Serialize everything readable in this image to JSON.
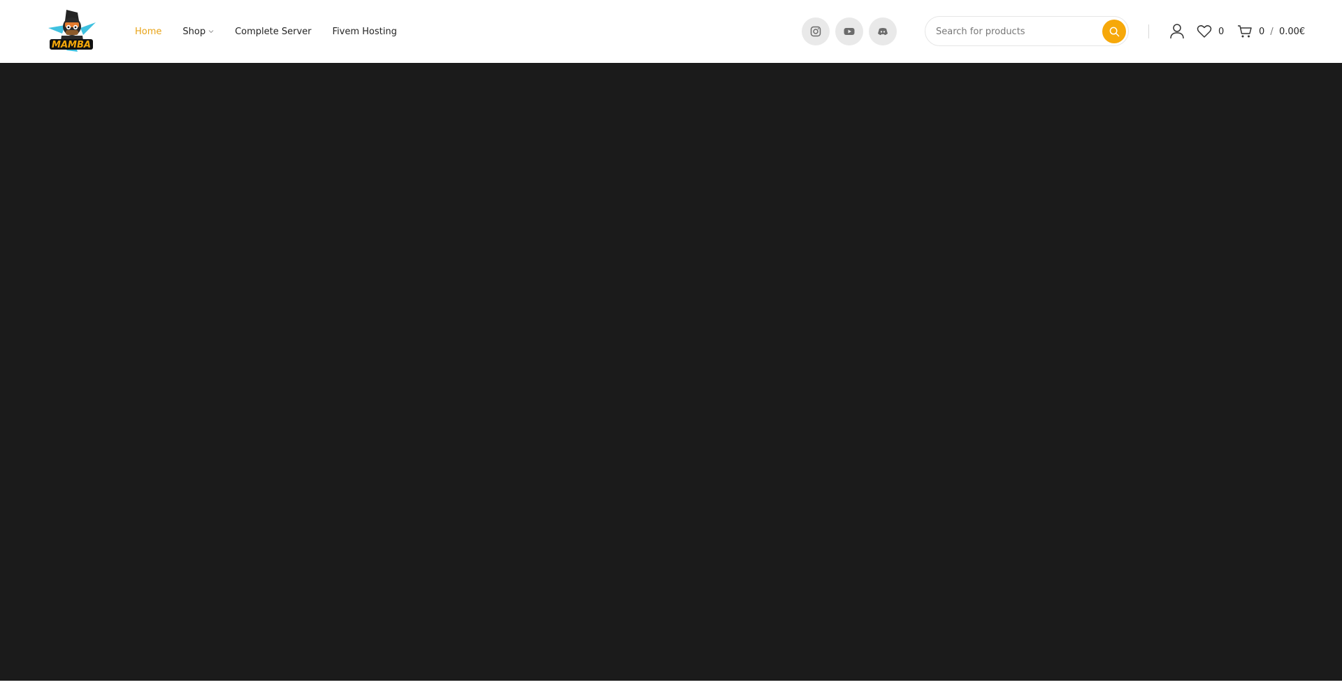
{
  "logo": {
    "text": "MAMBA"
  },
  "nav": {
    "items": [
      {
        "label": "Home",
        "active": true
      },
      {
        "label": "Shop",
        "has_dropdown": true
      },
      {
        "label": "Complete Server"
      },
      {
        "label": "Fivem Hosting"
      }
    ]
  },
  "socials": [
    {
      "icon": "instagram-icon"
    },
    {
      "icon": "youtube-icon"
    },
    {
      "icon": "discord-icon"
    }
  ],
  "search": {
    "placeholder": "Search for products",
    "button_icon": "search-icon"
  },
  "header_actions": {
    "account_icon": "user-icon",
    "wishlist_count": "0",
    "cart_count": "0",
    "cart_separator": "/",
    "cart_total": "0.00€"
  },
  "colors": {
    "accent": "#f6a80a",
    "nav_active": "#e8a317",
    "hero_background": "#1b1b1b",
    "social_circle": "#e9e9e9"
  }
}
